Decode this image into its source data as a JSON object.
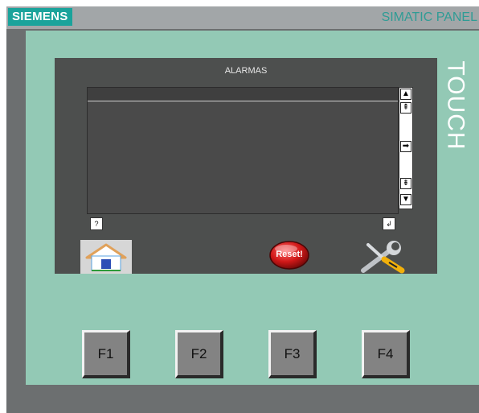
{
  "header": {
    "brand": "SIEMENS",
    "model": "SIMATIC PANEL",
    "side_label": "TOUCH"
  },
  "screen": {
    "title": "ALARMAS",
    "scroll_buttons": [
      {
        "icon": "arrow-up-icon",
        "glyph": "▲"
      },
      {
        "icon": "page-up-icon",
        "glyph": "⇞"
      },
      {
        "icon": "arrow-right-icon",
        "glyph": "➡"
      },
      {
        "icon": "page-down-icon",
        "glyph": "⇟"
      },
      {
        "icon": "arrow-down-icon",
        "glyph": "▼"
      }
    ],
    "help_button": "?",
    "enter_button": "↲",
    "reset_button": "Reset!"
  },
  "function_keys": [
    "F1",
    "F2",
    "F3",
    "F4"
  ],
  "colors": {
    "bezel": "#93c9b5",
    "brand": "#1aa39b",
    "screen": "#4d4f4e"
  }
}
